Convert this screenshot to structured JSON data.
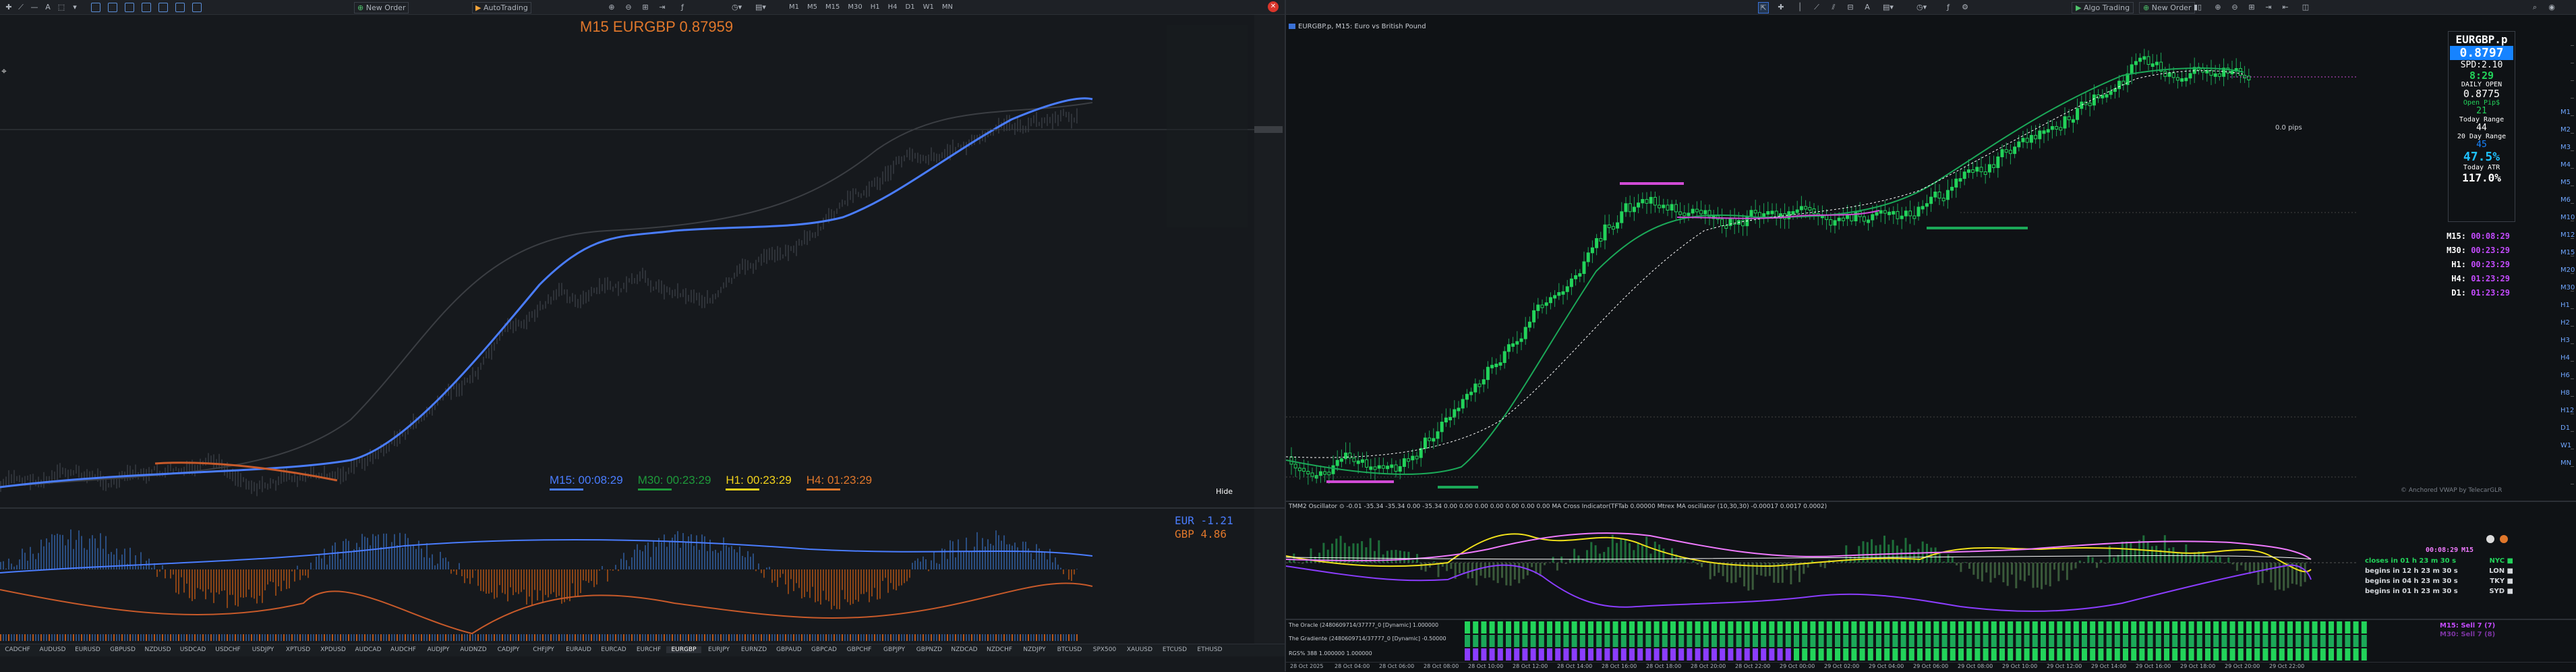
{
  "left_toolbar": {
    "new_order": "New Order",
    "algo": "AutoTrading",
    "timeframes": [
      "M1",
      "M5",
      "M15",
      "M30",
      "H1",
      "H4",
      "D1",
      "W1",
      "MN"
    ]
  },
  "right_toolbar": {
    "algo": "Algo Trading",
    "new_order": "New Order"
  },
  "left_chart": {
    "title": "M15 EURGBP 0.87959",
    "timers": [
      {
        "label": "M15: 00:08:29",
        "color": "#4a7dff"
      },
      {
        "label": "M30: 00:23:29",
        "color": "#1e9a3a"
      },
      {
        "label": "H1: 00:23:29",
        "color": "#f2d21b"
      },
      {
        "label": "H4: 01:23:29",
        "color": "#e0772b"
      }
    ],
    "hide_label": "Hide",
    "strength": [
      {
        "label": "EUR  -1.21",
        "color": "#4a7dff"
      },
      {
        "label": "GBP  4.86",
        "color": "#e0772b"
      }
    ],
    "symbol_tabs": [
      "CADCHF",
      "AUDUSD",
      "EURUSD",
      "GBPUSD",
      "NZDUSD",
      "USDCAD",
      "USDCHF",
      "USDJPY",
      "XPTUSD",
      "XPDUSD",
      "AUDCAD",
      "AUDCHF",
      "AUDJPY",
      "AUDNZD",
      "CADJPY",
      "CHFJPY",
      "EURAUD",
      "EURCAD",
      "EURCHF",
      "EURGBP",
      "EURJPY",
      "EURNZD",
      "GBPAUD",
      "GBPCAD",
      "GBPCHF",
      "GBPJPY",
      "GBPNZD",
      "NZDCAD",
      "NZDCHF",
      "NZDJPY",
      "BTCUSD",
      "SPX500",
      "XAUUSD",
      "ETCUSD",
      "ETHUSD"
    ]
  },
  "right_chart": {
    "header": "EURGBP.p, M15:  Euro vs British Pound",
    "info_panel": {
      "symbol": "EURGBP.p",
      "price": "0.8797",
      "spread": "SPD:2.10",
      "clock": "8:29",
      "daily_open_label": "DAILY OPEN",
      "daily_open": "0.8775",
      "open_pips": "Open Pip$",
      "open_pips_val": "21",
      "today_range_label": "Today Range",
      "today_range": "44",
      "day20_label": "20 Day Range",
      "day20": "45",
      "pct": "47.5%",
      "today_atr_label": "Today ATR",
      "today_atr": "117.0%"
    },
    "timers": [
      {
        "tf": "M15:",
        "val": "00:08:29"
      },
      {
        "tf": "M30:",
        "val": "00:23:29"
      },
      {
        "tf": "H1:",
        "val": "00:23:29"
      },
      {
        "tf": "H4:",
        "val": "01:23:29"
      },
      {
        "tf": "D1:",
        "val": "01:23:29"
      }
    ],
    "pips_label": "0.0 pips",
    "vwap_label": "© Anchored VWAP by TelecarGLR",
    "oscillator_header": "TMM2 Oscillator  ⊙ -0.01 -35.34 -35.34 0.00 -35.34 0.00 0.00 0.00 0.00 0.00 0.00 0.00 MA Cross Indicator(TFTab 0.00000 Mtrex MA oscillator (10,30,30) -0.00017 0.0017 0.0002)",
    "sessions": [
      {
        "text": "closes in 01 h 23 m 30 s",
        "tag": "NYC",
        "color": "#22d35a"
      },
      {
        "text": "begins in 12 h 23 m 30 s",
        "tag": "LON",
        "color": "#d6d9de"
      },
      {
        "text": "begins in 04 h 23 m 30 s",
        "tag": "TKY",
        "color": "#d6d9de"
      },
      {
        "text": "begins in 01 h 23 m 30 s",
        "tag": "SYD",
        "color": "#d6d9de"
      }
    ],
    "osc_time": "00:08:29",
    "osc_tf": "M15",
    "strip_labels": [
      "M15: Sell 7 (7)",
      "M30: Sell 7 (8)"
    ],
    "bottom_rows": [
      "The Oracle (2480609714/37777_0 [Dynamic] 1.000000",
      "The Gradiente (2480609714/37777_0 [Dynamic] -0.50000",
      "RGS% 388 1.000000 1.000000"
    ],
    "time_axis": [
      "28 Oct 2025",
      "28 Oct 04:00",
      "28 Oct 06:00",
      "28 Oct 08:00",
      "28 Oct 10:00",
      "28 Oct 12:00",
      "28 Oct 14:00",
      "28 Oct 16:00",
      "28 Oct 18:00",
      "28 Oct 20:00",
      "28 Oct 22:00",
      "29 Oct 00:00",
      "29 Oct 02:00",
      "29 Oct 04:00",
      "29 Oct 06:00",
      "29 Oct 08:00",
      "29 Oct 10:00",
      "29 Oct 12:00",
      "29 Oct 14:00",
      "29 Oct 16:00",
      "29 Oct 18:00",
      "29 Oct 20:00",
      "29 Oct 22:00"
    ],
    "tf_column": [
      "M1",
      "M2",
      "M3",
      "M4",
      "M5",
      "M6",
      "M10",
      "M12",
      "M15",
      "M20",
      "M30",
      "H1",
      "H2",
      "H3",
      "H4",
      "H6",
      "H8",
      "H12",
      "D1",
      "W1",
      "MN"
    ]
  }
}
